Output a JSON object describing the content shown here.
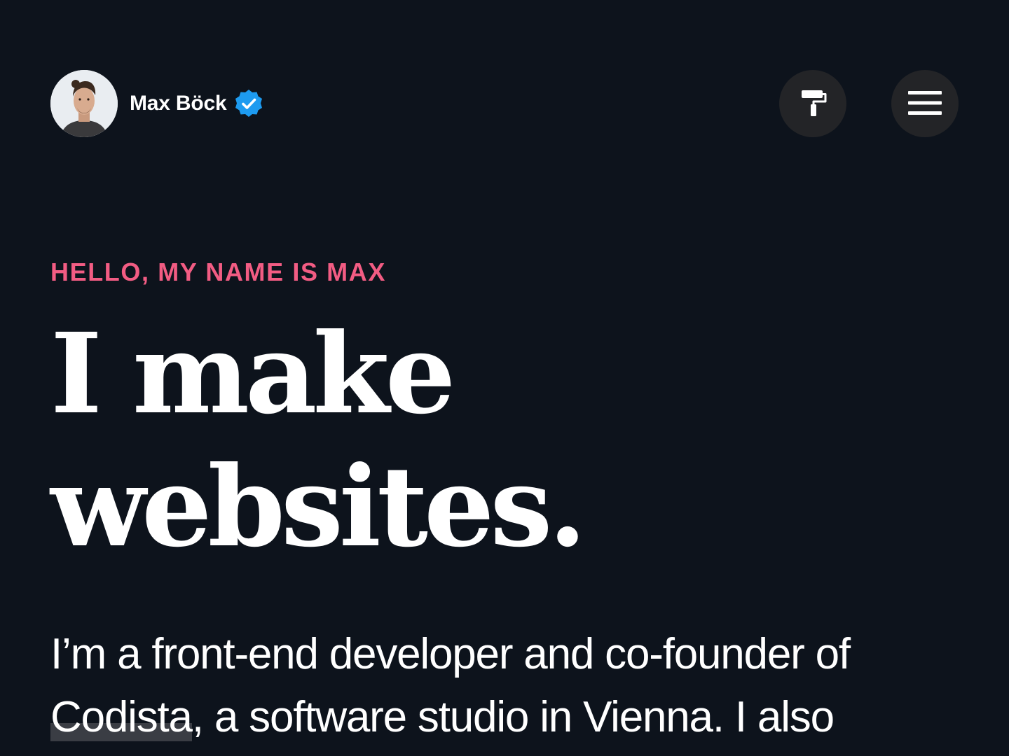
{
  "header": {
    "site_name": "Max Böck",
    "avatar_icon": "avatar-photo",
    "verified_icon": "verified-badge-icon",
    "theme_button_icon": "paint-roller-icon",
    "menu_button_icon": "hamburger-menu-icon"
  },
  "hero": {
    "eyebrow": "HELLO, MY NAME IS MAX",
    "headline_line1": "I make",
    "headline_line2": "websites.",
    "intro_part1": "I’m a front-end developer and co-founder of ",
    "intro_link": "Codista",
    "intro_part2": ", a software studio in Vienna. I also"
  },
  "colors": {
    "background": "#0d131c",
    "accent": "#f25c83",
    "verified": "#1d9bf0",
    "button": "#232427"
  }
}
